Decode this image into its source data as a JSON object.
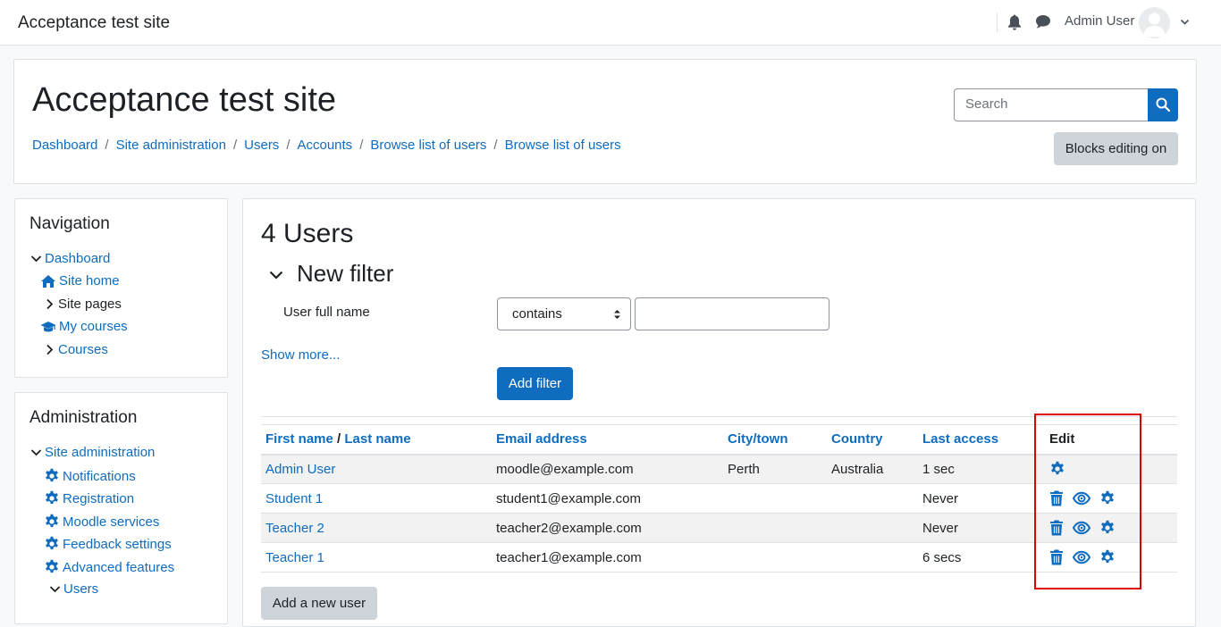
{
  "navbar": {
    "site_name": "Acceptance test site",
    "user_name": "Admin User"
  },
  "header": {
    "title": "Acceptance test site",
    "breadcrumb": [
      "Dashboard",
      "Site administration",
      "Users",
      "Accounts",
      "Browse list of users",
      "Browse list of users"
    ],
    "search_placeholder": "Search",
    "blocks_editing_label": "Blocks editing on"
  },
  "navigation": {
    "title": "Navigation",
    "items": [
      {
        "label": "Dashboard",
        "icon": "chevron-down-icon"
      },
      {
        "label": "Site home",
        "icon": "home-icon"
      },
      {
        "label": "Site pages",
        "icon": "chevron-right-icon"
      },
      {
        "label": "My courses",
        "icon": "graduation-cap-icon"
      },
      {
        "label": "Courses",
        "icon": "chevron-right-icon"
      }
    ]
  },
  "administration": {
    "title": "Administration",
    "items": [
      {
        "label": "Site administration",
        "icon": "chevron-down-icon"
      },
      {
        "label": "Notifications",
        "icon": "gear-icon"
      },
      {
        "label": "Registration",
        "icon": "gear-icon"
      },
      {
        "label": "Moodle services",
        "icon": "gear-icon"
      },
      {
        "label": "Feedback settings",
        "icon": "gear-icon"
      },
      {
        "label": "Advanced features",
        "icon": "gear-icon"
      },
      {
        "label": "Users",
        "icon": "chevron-down-icon"
      }
    ]
  },
  "main": {
    "heading": "4 Users",
    "filter": {
      "title": "New filter",
      "field_label": "User full name",
      "operator": "contains",
      "value": "",
      "show_more": "Show more...",
      "add_filter": "Add filter"
    },
    "table": {
      "headers": {
        "first_name": "First name",
        "name_sep": " / ",
        "last_name": "Last name",
        "email": "Email address",
        "city": "City/town",
        "country": "Country",
        "last_access": "Last access",
        "edit": "Edit"
      },
      "rows": [
        {
          "name": "Admin User",
          "email": "moodle@example.com",
          "city": "Perth",
          "country": "Australia",
          "last_access": "1 sec"
        },
        {
          "name": "Student 1",
          "email": "student1@example.com",
          "city": "",
          "country": "",
          "last_access": "Never"
        },
        {
          "name": "Teacher 2",
          "email": "teacher2@example.com",
          "city": "",
          "country": "",
          "last_access": "Never"
        },
        {
          "name": "Teacher 1",
          "email": "teacher1@example.com",
          "city": "",
          "country": "",
          "last_access": "6 secs"
        }
      ]
    },
    "add_user": "Add a new user"
  },
  "colors": {
    "link": "#0f6cbf",
    "primary": "#0f6cbf",
    "secondary_button": "#ced4da",
    "highlight_box": "#e00000"
  }
}
